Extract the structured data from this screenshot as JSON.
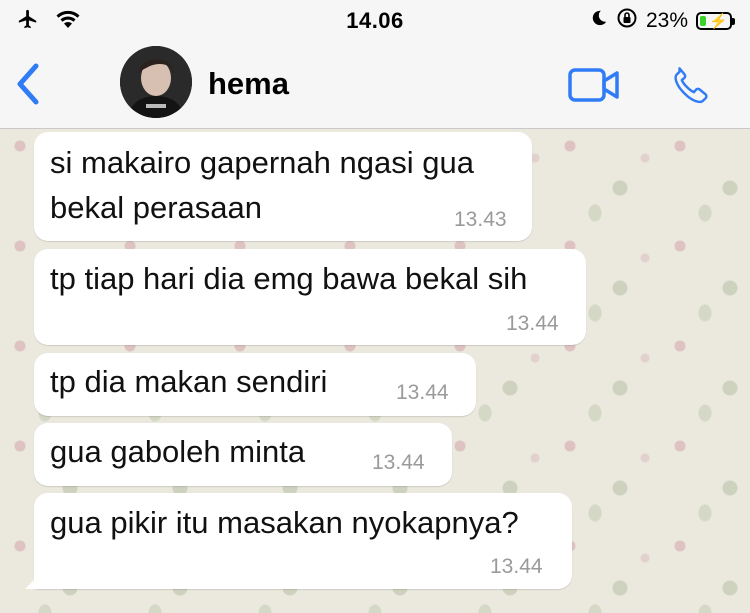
{
  "status_bar": {
    "time": "14.06",
    "battery_percent": "23%",
    "battery_level": 0.23,
    "icons": [
      "airplane-icon",
      "wifi-icon",
      "moon-icon",
      "orientation-lock-icon",
      "battery-icon"
    ]
  },
  "header": {
    "contact_name": "hema",
    "icons": [
      "back-icon",
      "video-call-icon",
      "phone-call-icon"
    ],
    "accent_color": "#2f7cf6"
  },
  "messages": [
    {
      "text": "si makairo gapernah ngasi gua\nbekal perasaan",
      "time": "13.43"
    },
    {
      "text": "tp tiap hari dia emg bawa bekal sih",
      "time": "13.44"
    },
    {
      "text": "tp dia makan sendiri",
      "time": "13.44"
    },
    {
      "text": "gua gaboleh minta",
      "time": "13.44"
    },
    {
      "text": "gua pikir itu masakan nyokapnya?",
      "time": "13.44"
    }
  ]
}
